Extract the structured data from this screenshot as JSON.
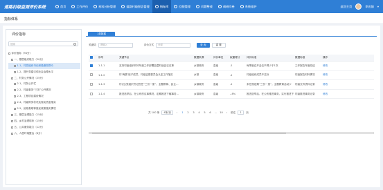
{
  "app": {
    "title": "道路村级监测评价系统"
  },
  "nav": [
    {
      "label": "首页",
      "icon": "home-icon",
      "active": false
    },
    {
      "label": "工作评价",
      "icon": "clipboard-icon",
      "active": false
    },
    {
      "label": "材料分析管理",
      "icon": "chart-icon",
      "active": false
    },
    {
      "label": "道路村级报告管理",
      "icon": "document-icon",
      "active": false
    },
    {
      "label": "指标库",
      "icon": "list-icon",
      "active": true
    },
    {
      "label": "回报管理",
      "icon": "reply-icon",
      "active": false
    },
    {
      "label": "问题整改",
      "icon": "tool-icon",
      "active": false
    },
    {
      "label": "调研问卷",
      "icon": "survey-icon",
      "active": false
    },
    {
      "label": "系统维护",
      "icon": "gear-icon",
      "active": false
    }
  ],
  "topright": {
    "back_label": "返回主页",
    "user_name": "李迅赫"
  },
  "page": {
    "title": "指标体系",
    "section": "指标体系"
  },
  "left": {
    "title": "评价指标",
    "search_placeholder": "搜索",
    "tree": [
      {
        "label": "评价指标（94分）",
        "indent": 0,
        "selected": false
      },
      {
        "label": "一、基层组织能力（20分）",
        "indent": 1,
        "selected": false
      },
      {
        "label": "1-1、村党组织书记积极服务群众",
        "indent": 2,
        "selected": true
      },
      {
        "label": "1-2、提升党建引领社会治理水平",
        "indent": 2,
        "selected": false
      },
      {
        "label": "二、村务公开情况（25分）",
        "indent": 1,
        "selected": false
      },
      {
        "label": "2-1、村务公开栏",
        "indent": 2,
        "selected": false
      },
      {
        "label": "2-2、村级事务“三务”公开情况",
        "indent": 2,
        "selected": false
      },
      {
        "label": "2-3、工程项目建设情况",
        "indent": 2,
        "selected": false
      },
      {
        "label": "2-4、村级财务状况及惠民资金落实",
        "indent": 2,
        "selected": false
      },
      {
        "label": "2-5、民政救助等惠民政策落实情况",
        "indent": 2,
        "selected": false
      },
      {
        "label": "三、基层治理能力（15分）",
        "indent": 1,
        "selected": false
      },
      {
        "label": "四、乡村治理现状（15分）",
        "indent": 1,
        "selected": false
      },
      {
        "label": "五、公共服务能力（12分）",
        "indent": 1,
        "selected": false
      },
      {
        "label": "六、人居环境整治（8分）",
        "indent": 1,
        "selected": false
      }
    ]
  },
  "right": {
    "tab_label": "1类数据",
    "filter": {
      "keyword_label": "关键词",
      "keyword_placeholder": "请输入",
      "type_label": "评价方式",
      "type_placeholder": "全部",
      "query_label": "查 询",
      "reset_label": "重 置"
    },
    "columns": [
      "序号",
      "关键节点",
      "数据来源",
      "评价单位",
      "权重得分",
      "评价标准",
      "数据标准",
      "操作"
    ],
    "rows": [
      {
        "checked": true,
        "no": "1-1-1",
        "key": "支持村级组织开好年度工作部署会暨村级会议议事",
        "source": "乡镇政府",
        "unit": "县级",
        "score": "-1",
        "standard": "每季度召开会议不得少于1次",
        "data_std": "工作报告年度总结",
        "op": "修改"
      },
      {
        "checked": false,
        "no": "1-1-2",
        "key": "村‘两委’班子成员、村级监督委员会认定工作落实",
        "source": "乡镇",
        "unit": "县级",
        "score": "-1",
        "standard": "村级组织成员不达标",
        "data_std": "村级报告材料情况",
        "op": "修改"
      },
      {
        "checked": false,
        "no": "1-1-3",
        "key": "村(社)党组织书记担任“三份一册”、主题教育、民主…",
        "source": "乡镇政府",
        "unit": "县级",
        "score": "-1",
        "standard": "未在规定期“三份一册”，主题教育活动少",
        "data_std": "村级文件资料记录",
        "op": "修改"
      },
      {
        "checked": false,
        "no": "1-1-4",
        "key": "推进选举后、在公布的议事情况、定期推进下辖事务…",
        "source": "乡镇政府",
        "unit": "县级",
        "score": "-.8%",
        "standard": "推进选举后、在公布推进事务、实行推进下辖事务情况",
        "data_std": "村级推进事务记录",
        "op": "修改"
      }
    ],
    "pagination": {
      "total_label": "共 100 条",
      "page_size": "4条/页",
      "pages": [
        "1",
        "2",
        "3",
        "4",
        "5",
        "6",
        "…",
        "10"
      ],
      "current": "1",
      "goto_label": "前往",
      "goto_value": "1",
      "page_unit": "页"
    }
  }
}
